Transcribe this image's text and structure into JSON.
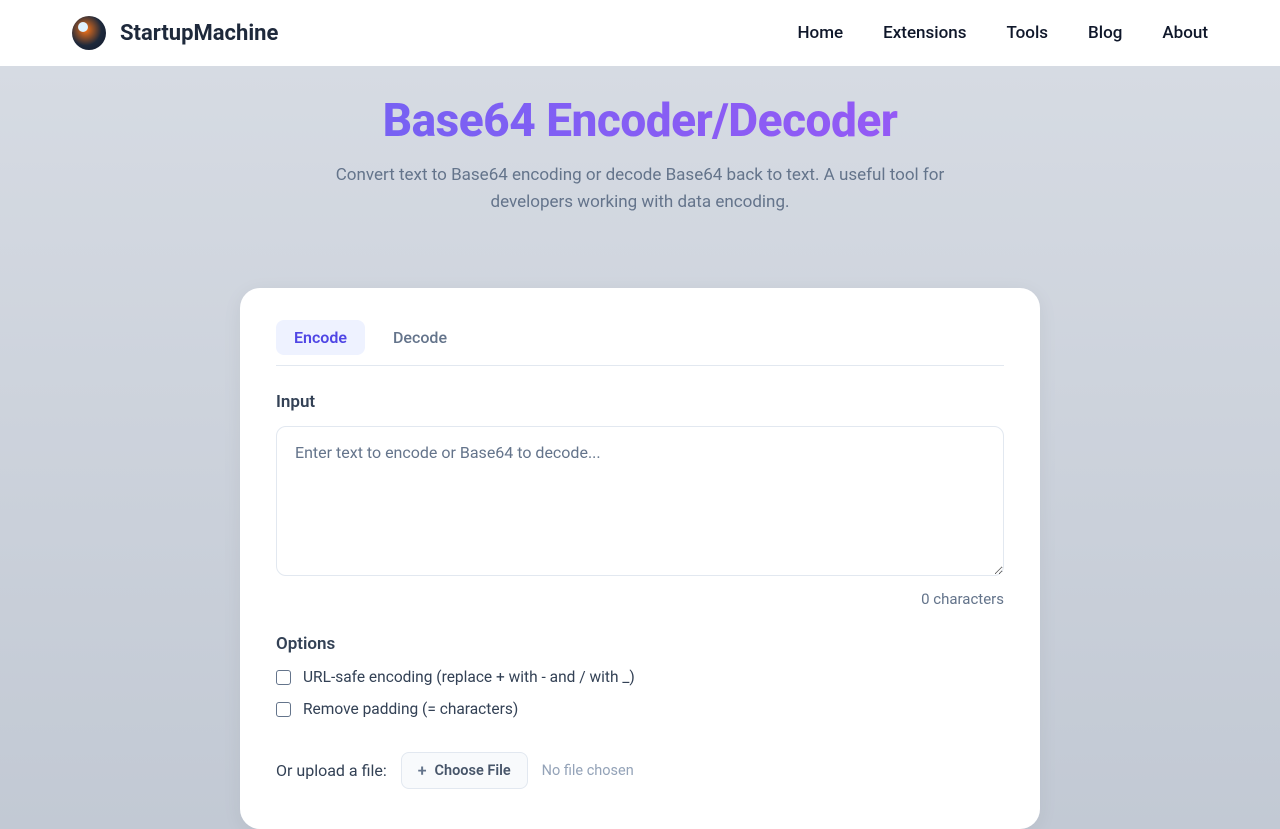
{
  "header": {
    "brand": "StartupMachine",
    "nav": [
      "Home",
      "Extensions",
      "Tools",
      "Blog",
      "About"
    ]
  },
  "hero": {
    "title": "Base64 Encoder/Decoder",
    "subtitle": "Convert text to Base64 encoding or decode Base64 back to text. A useful tool for developers working with data encoding."
  },
  "card": {
    "tabs": {
      "encode": "Encode",
      "decode": "Decode"
    },
    "input_label": "Input",
    "input_placeholder": "Enter text to encode or Base64 to decode...",
    "char_count": "0 characters",
    "options_label": "Options",
    "option_url_safe": "URL-safe encoding (replace + with - and / with _)",
    "option_remove_padding": "Remove padding (= characters)",
    "upload_label": "Or upload a file:",
    "choose_file_label": "Choose File",
    "no_file_text": "No file chosen"
  }
}
